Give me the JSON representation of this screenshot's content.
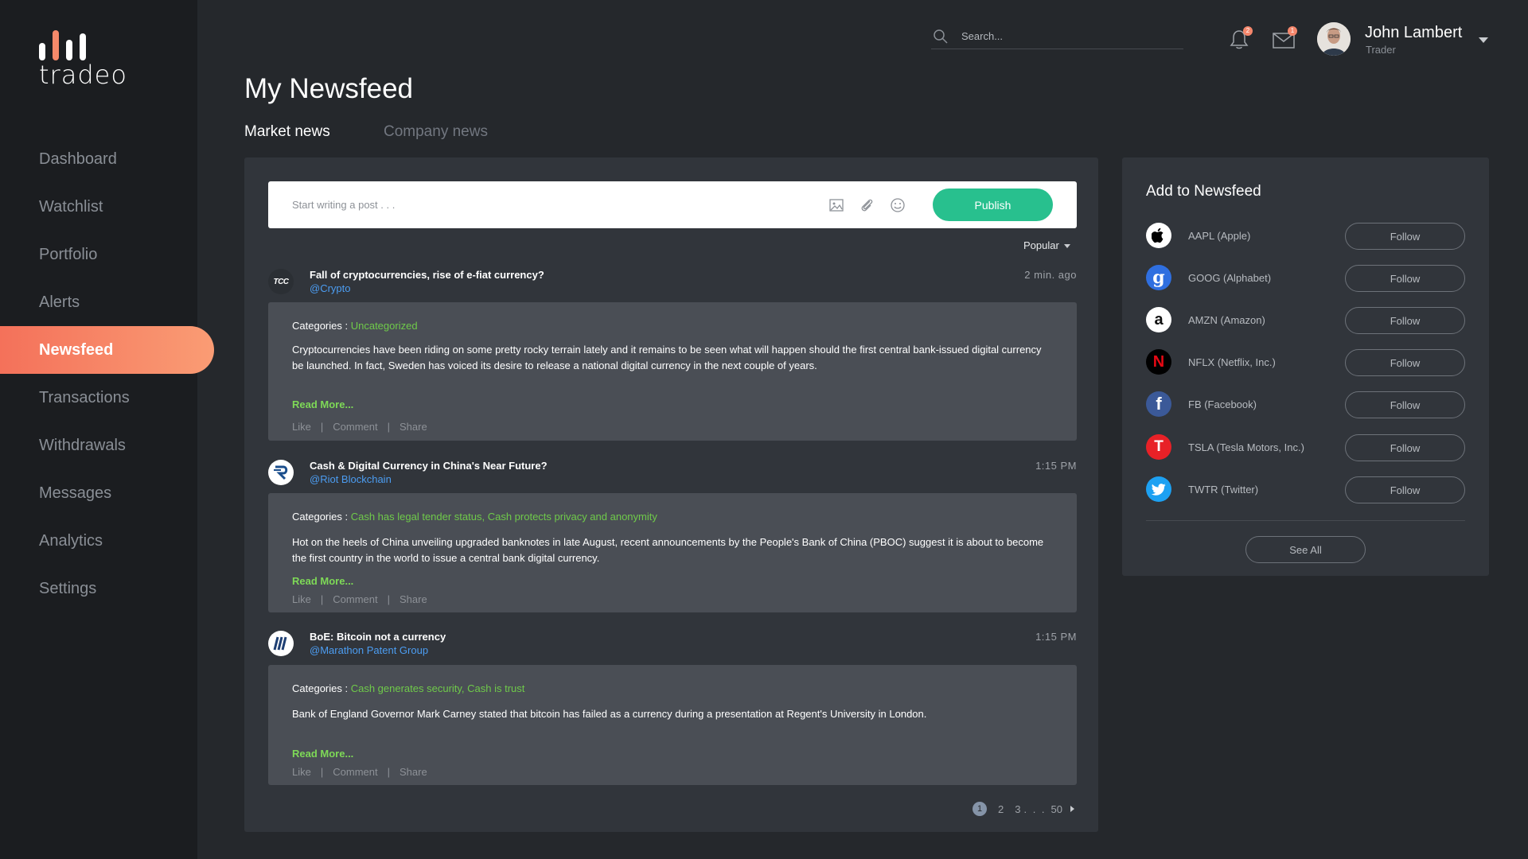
{
  "brand": {
    "name": "tradeo",
    "accent": "#f5896a",
    "publish_color": "#28c08e",
    "link_color": "#4c9df2",
    "category_color": "#6fca4a"
  },
  "sidebar": {
    "items": [
      {
        "label": "Dashboard",
        "active": false
      },
      {
        "label": "Watchlist",
        "active": false
      },
      {
        "label": "Portfolio",
        "active": false
      },
      {
        "label": "Alerts",
        "active": false
      },
      {
        "label": "Newsfeed",
        "active": true
      },
      {
        "label": "Transactions",
        "active": false
      },
      {
        "label": "Withdrawals",
        "active": false
      },
      {
        "label": "Messages",
        "active": false
      },
      {
        "label": "Analytics",
        "active": false
      },
      {
        "label": "Settings",
        "active": false
      }
    ]
  },
  "header": {
    "search_placeholder": "Search...",
    "notifications_count": "2",
    "messages_count": "1",
    "user_name": "John Lambert",
    "user_role": "Trader"
  },
  "page": {
    "title": "My Newsfeed",
    "tabs": [
      {
        "label": "Market news",
        "active": true
      },
      {
        "label": "Company news",
        "active": false
      }
    ]
  },
  "composer": {
    "placeholder": "Start writing a post . . .",
    "publish_label": "Publish"
  },
  "sort": {
    "selected": "Popular"
  },
  "posts": [
    {
      "logo": "TCC",
      "title": "Fall of cryptocurrencies, rise of e-fiat currency?",
      "handle": "@Crypto",
      "time": "2 min. ago",
      "categories_label": "Categories :",
      "categories": "Uncategorized",
      "body": "Cryptocurrencies have been riding on some pretty rocky terrain lately and it remains to be seen what will happen should the first central bank-issued digital currency be launched. In fact, Sweden has voiced its desire to release a national digital currency in the next couple of years.",
      "read_more": "Read More...",
      "actions": [
        "Like",
        "Comment",
        "Share"
      ]
    },
    {
      "logo": "R",
      "title": "Cash & Digital Currency in China's Near Future?",
      "handle": "@Riot Blockchain",
      "time": "1:15 PM",
      "categories_label": "Categories :",
      "categories": "Cash has legal tender status, Cash protects privacy and anonymity",
      "body": "Hot on the heels of China unveiling upgraded banknotes in late August, recent announcements by the People's Bank of China (PBOC) suggest it is about to become the first country in the world to issue a central bank digital currency.",
      "read_more": "Read More...",
      "actions": [
        "Like",
        "Comment",
        "Share"
      ]
    },
    {
      "logo": "M",
      "title": "BoE: Bitcoin not a currency",
      "handle": "@Marathon Patent Group",
      "time": "1:15 PM",
      "categories_label": "Categories :",
      "categories": "Cash generates security, Cash is trust",
      "body": "Bank of England Governor Mark Carney stated that bitcoin has failed as a currency during a presentation at Regent's University in London.",
      "read_more": "Read More...",
      "actions": [
        "Like",
        "Comment",
        "Share"
      ]
    }
  ],
  "pagination": {
    "current": "1",
    "pages": [
      "2",
      "3"
    ],
    "ellipsis": ". . .",
    "last": "50"
  },
  "side_panel": {
    "title": "Add to Newsfeed",
    "follow_label": "Follow",
    "see_all_label": "See All",
    "stocks": [
      {
        "name": "AAPL (Apple)",
        "icon": "apple-icon",
        "bg": "#ffffff",
        "fg": "#000000",
        "glyph": ""
      },
      {
        "name": "GOOG (Alphabet)",
        "icon": "google-icon",
        "bg": "#2f6fe0",
        "fg": "#ffffff",
        "glyph": "g"
      },
      {
        "name": "AMZN (Amazon)",
        "icon": "amazon-icon",
        "bg": "#ffffff",
        "fg": "#111111",
        "glyph": "a"
      },
      {
        "name": "NFLX (Netflix, Inc.)",
        "icon": "netflix-icon",
        "bg": "#000000",
        "fg": "#e50914",
        "glyph": "N"
      },
      {
        "name": "FB (Facebook)",
        "icon": "facebook-icon",
        "bg": "#3b5998",
        "fg": "#ffffff",
        "glyph": "f"
      },
      {
        "name": "TSLA (Tesla Motors, Inc.)",
        "icon": "tesla-icon",
        "bg": "#e82127",
        "fg": "#ffffff",
        "glyph": "T"
      },
      {
        "name": "TWTR (Twitter)",
        "icon": "twitter-icon",
        "bg": "#1da1f2",
        "fg": "#ffffff",
        "glyph": ""
      }
    ]
  }
}
